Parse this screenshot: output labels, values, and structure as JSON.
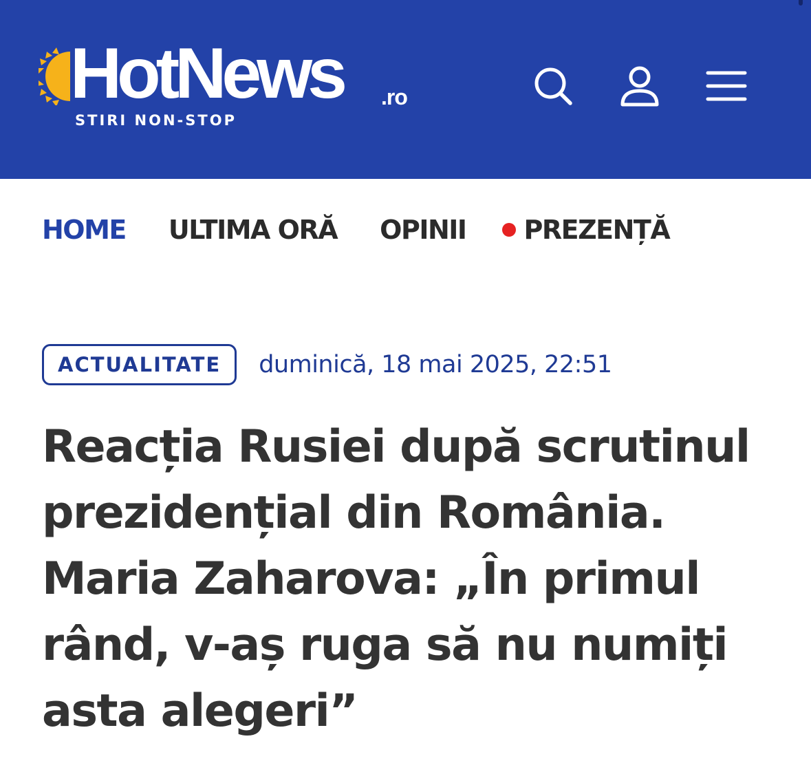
{
  "header": {
    "background_color": "#2342a8",
    "logo": {
      "wordmark": "HotNews",
      "tld": ".ro",
      "tagline": "STIRI NON-STOP",
      "sun_color": "#f6b21a"
    },
    "actions": [
      {
        "icon": "search-icon"
      },
      {
        "icon": "user-icon"
      },
      {
        "icon": "menu-icon"
      }
    ]
  },
  "nav": {
    "items": [
      {
        "label": "HOME",
        "active": true
      },
      {
        "label": "ULTIMA ORĂ",
        "active": false
      },
      {
        "label": "OPINII",
        "active": false
      },
      {
        "label": "PREZENȚĂ",
        "active": false,
        "live_dot_color": "#e62222"
      }
    ]
  },
  "article": {
    "category": "ACTUALITATE",
    "date": "duminică, 18 mai 2025, 22:51",
    "headline": "Reacția Rusiei după scrutinul prezidențial din România. Maria Zaharova: „În primul rând, v-aș ruga să nu numiți asta alegeri”",
    "accent_color": "#1f3a94",
    "text_color": "#333333"
  }
}
